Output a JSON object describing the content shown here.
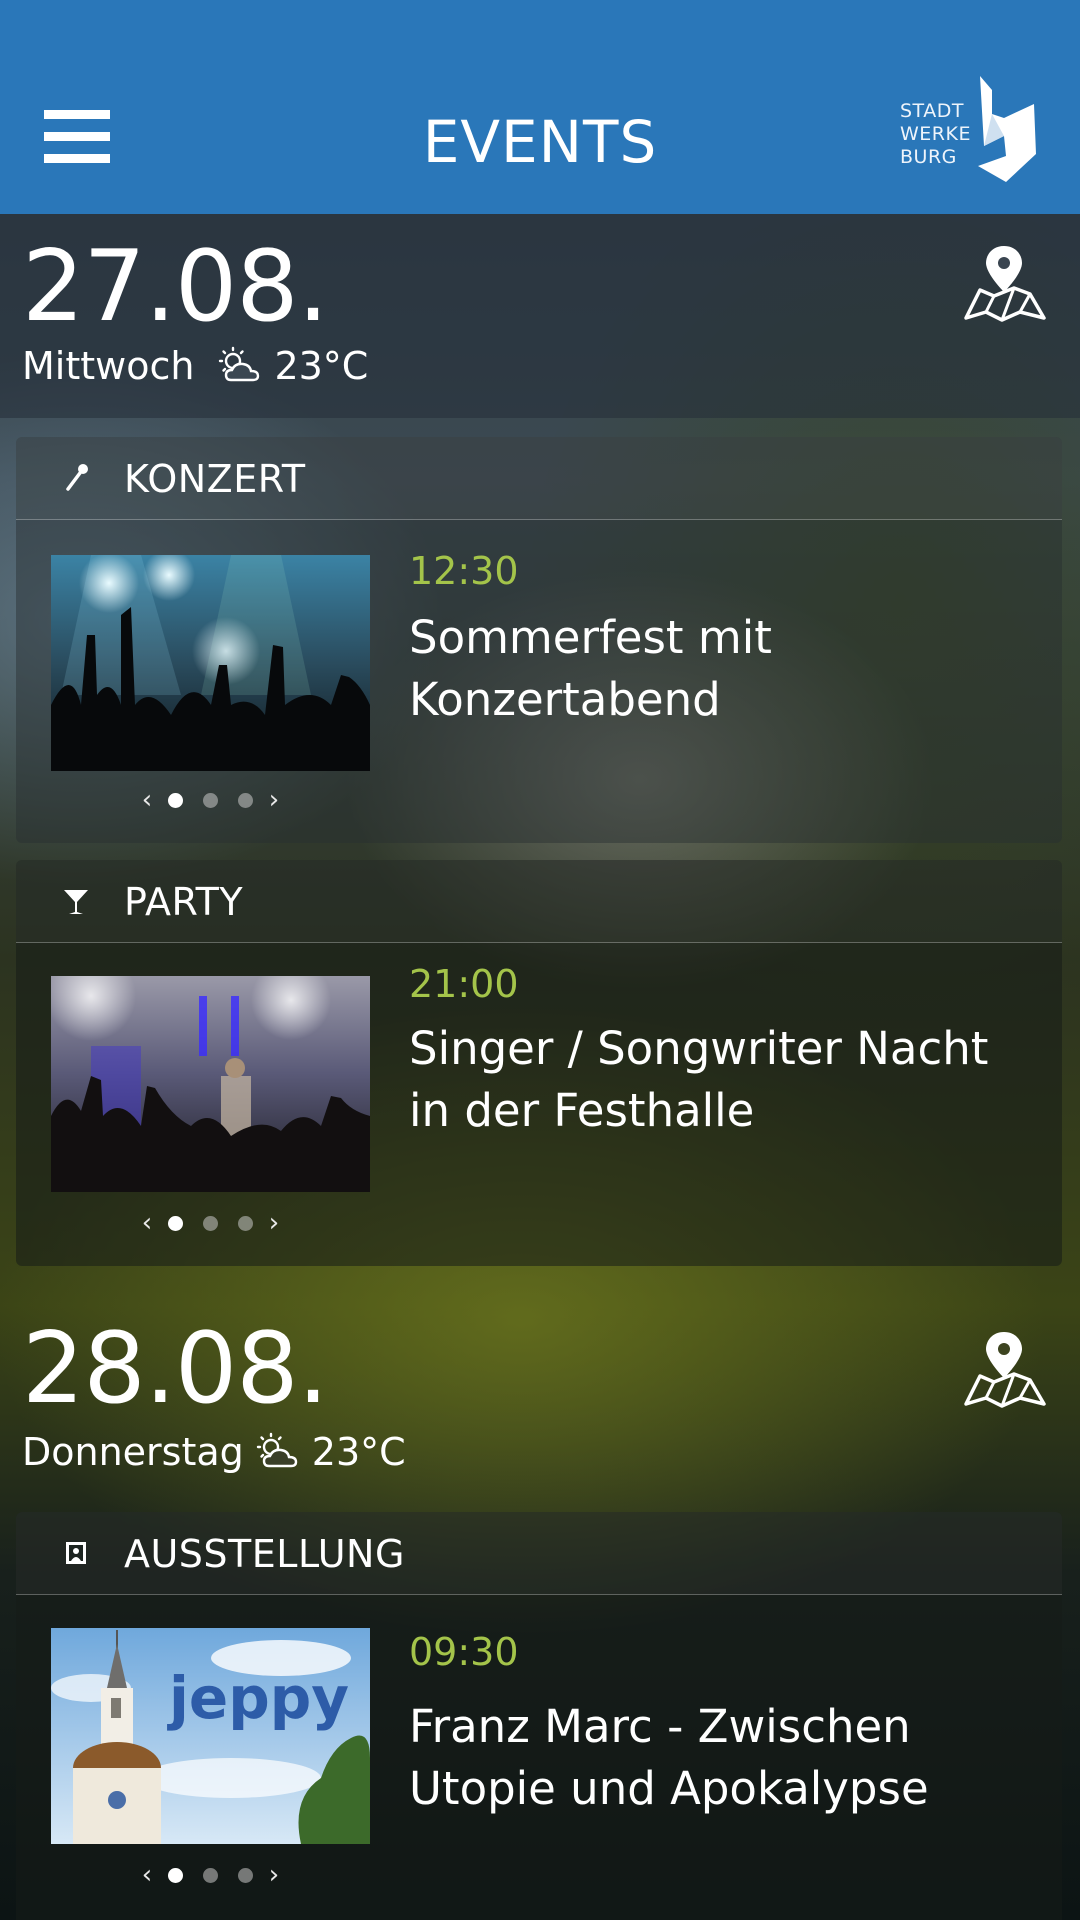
{
  "header": {
    "title": "EVENTS",
    "logo_lines": [
      "STADT",
      "WERKE",
      "BURG"
    ]
  },
  "days": [
    {
      "date": "27.08.",
      "weekday": "Mittwoch",
      "temperature": "23°C",
      "weather_icon": "partly-cloudy-icon",
      "events": [
        {
          "category": "KONZERT",
          "category_icon": "microphone-icon",
          "time": "12:30",
          "title_line1": "Sommerfest mit",
          "title_line2": "Konzertabend",
          "image": "concert-crowd-image",
          "pager_total": 3,
          "pager_active": 1
        },
        {
          "category": "PARTY",
          "category_icon": "cocktail-glass-icon",
          "time": "21:00",
          "title_line1": "Singer / Songwriter Nacht",
          "title_line2": "in der Festhalle",
          "image": "stage-crowd-image",
          "pager_total": 3,
          "pager_active": 1
        }
      ]
    },
    {
      "date": "28.08.",
      "weekday": "Donnerstag",
      "temperature": "23°C",
      "weather_icon": "partly-cloudy-icon",
      "events": [
        {
          "category": "AUSSTELLUNG",
          "category_icon": "portrait-frame-icon",
          "time": "09:30",
          "title_line1": "Franz Marc - Zwischen",
          "title_line2": "Utopie und Apokalypse",
          "image": "church-tower-image",
          "image_text": "jeppy",
          "pager_total": 3,
          "pager_active": 1
        }
      ]
    }
  ],
  "colors": {
    "header_bg": "#2a77b9",
    "time_accent": "#a4c44a",
    "text": "#ffffff"
  }
}
